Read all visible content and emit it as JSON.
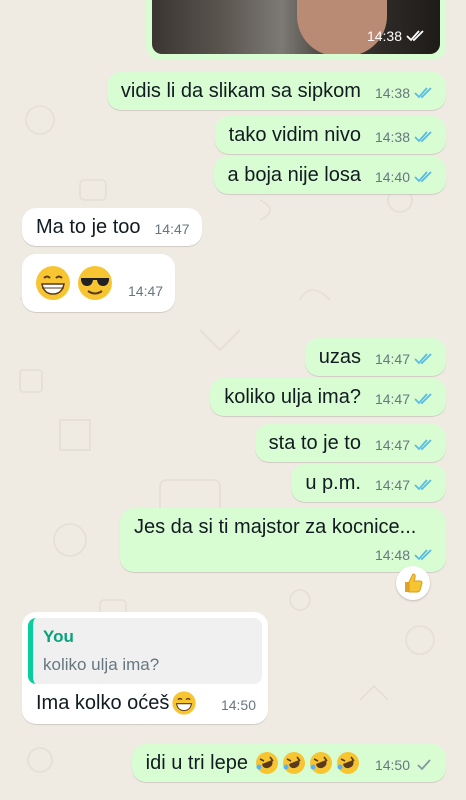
{
  "colors": {
    "outgoing_bubble": "#d9fdd3",
    "incoming_bubble": "#ffffff",
    "read_tick": "#53bdeb",
    "sent_tick": "#8696a0",
    "quote_bar": "#06cf9c"
  },
  "top_photo": {
    "time": "14:38",
    "status_icon": "double-check-read-icon"
  },
  "messages": [
    {
      "text": "vidis li da slikam sa sipkom",
      "time": "14:38"
    },
    {
      "text": "tako vidim nivo",
      "time": "14:38"
    },
    {
      "text": "a boja nije losa",
      "time": "14:40"
    },
    {
      "text": "Ma to je too",
      "time": "14:47"
    },
    {
      "text": "",
      "time": "14:47",
      "emojis": [
        "grinning-face-icon",
        "sunglasses-face-icon"
      ]
    },
    {
      "text": "uzas",
      "time": "14:47"
    },
    {
      "text": "koliko ulja ima?",
      "time": "14:47"
    },
    {
      "text": "sta to je to",
      "time": "14:47"
    },
    {
      "text": "u p.m.",
      "time": "14:47"
    },
    {
      "text": "Jes da si ti majstor za kocnice...",
      "time": "14:48",
      "reaction": "thumbs-up-icon"
    },
    {
      "quote_author": "You",
      "quote_text": "koliko ulja ima?",
      "text": "Ima kolko oćeš",
      "time": "14:50",
      "emojis": [
        "grinning-face-icon"
      ]
    },
    {
      "text": "idi u tri lepe",
      "time": "14:50",
      "emojis": [
        "rolling-laughing-icon",
        "rolling-laughing-icon",
        "rolling-laughing-icon",
        "rolling-laughing-icon"
      ]
    }
  ]
}
